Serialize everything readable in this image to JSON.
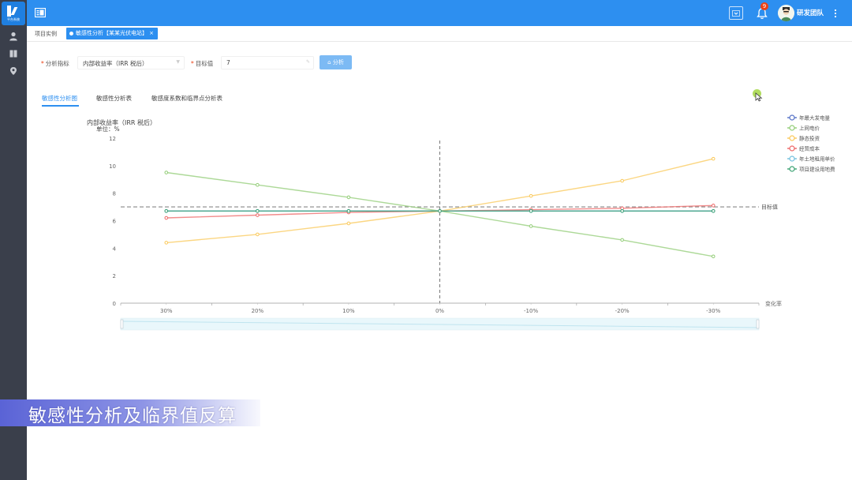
{
  "app": {
    "logo_text": "平台系统",
    "notification_count": "9",
    "user_name": "研发团队"
  },
  "tabs": {
    "home": "项目实例",
    "active": "敏感性分析【某某光伏电站】",
    "close": "×"
  },
  "form": {
    "indicator_label": "分析指标",
    "indicator_value": "内部收益率（IRR 税后）",
    "target_label": "目标值",
    "target_value": "7",
    "analyze_button": "分析",
    "required_mark": "*"
  },
  "subtabs": [
    "敏感性分析图",
    "敏感性分析表",
    "敏感度系数和临界点分析表"
  ],
  "chart_data": {
    "type": "line",
    "ylabel": "内部收益率（IRR 税后）",
    "yunit": "单位：%",
    "xlabel": "变化率",
    "categories": [
      "30%",
      "20%",
      "10%",
      "0%",
      "-10%",
      "-20%",
      "-30%"
    ],
    "ylim": [
      0,
      12
    ],
    "yticks": [
      0,
      2,
      4,
      6,
      8,
      10,
      12
    ],
    "target": {
      "value": 7,
      "label": "目标值"
    },
    "legend_position": "top-right",
    "series": [
      {
        "name": "年最大发电量",
        "color": "#5470c6",
        "values": [
          6.7,
          6.7,
          6.7,
          6.7,
          6.7,
          6.7,
          6.7
        ]
      },
      {
        "name": "上网电价",
        "color": "#91cc75",
        "values": [
          9.5,
          8.6,
          7.7,
          6.7,
          5.6,
          4.6,
          3.4
        ]
      },
      {
        "name": "静态投资",
        "color": "#fac858",
        "values": [
          4.4,
          5.0,
          5.8,
          6.7,
          7.8,
          8.9,
          10.5
        ]
      },
      {
        "name": "经营成本",
        "color": "#ee6666",
        "values": [
          6.2,
          6.4,
          6.6,
          6.7,
          6.8,
          6.9,
          7.1
        ]
      },
      {
        "name": "年土地租用单价",
        "color": "#73c0de",
        "values": [
          6.7,
          6.7,
          6.7,
          6.7,
          6.7,
          6.7,
          6.7
        ]
      },
      {
        "name": "项目建设用地费",
        "color": "#3ba272",
        "values": [
          6.7,
          6.7,
          6.7,
          6.7,
          6.7,
          6.7,
          6.7
        ]
      }
    ]
  },
  "caption": "敏感性分析及临界值反算"
}
